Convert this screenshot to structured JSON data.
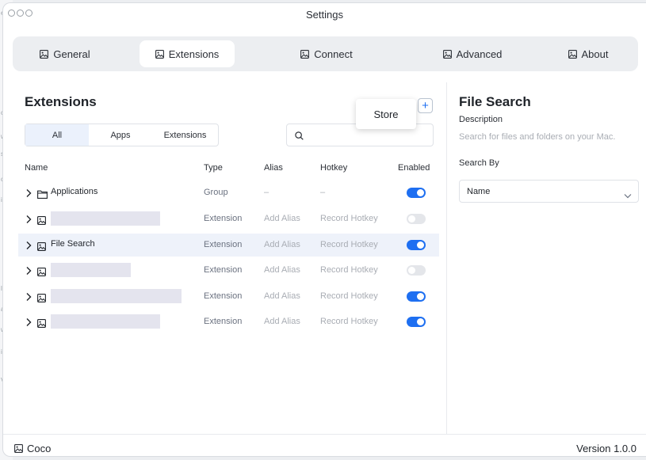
{
  "window": {
    "title": "Settings"
  },
  "tabs": [
    {
      "label": "General",
      "active": false
    },
    {
      "label": "Extensions",
      "active": true
    },
    {
      "label": "Connect",
      "active": false
    },
    {
      "label": "Advanced",
      "active": false
    },
    {
      "label": "About",
      "active": false
    }
  ],
  "extensions": {
    "title": "Extensions",
    "store_label": "Store",
    "add_label": "+",
    "filters": [
      {
        "label": "All",
        "active": true
      },
      {
        "label": "Apps",
        "active": false
      },
      {
        "label": "Extensions",
        "active": false
      }
    ],
    "search": {
      "value": "",
      "placeholder": ""
    },
    "columns": {
      "name": "Name",
      "type": "Type",
      "alias": "Alias",
      "hotkey": "Hotkey",
      "enabled": "Enabled"
    },
    "rows": [
      {
        "name": "Applications",
        "icon": "folder-icon",
        "type": "Group",
        "alias": "–",
        "hotkey": "–",
        "enabled": true,
        "selected": false
      },
      {
        "name": "",
        "icon": "image-icon",
        "type": "Extension",
        "alias": "Add Alias",
        "hotkey": "Record Hotkey",
        "enabled": false,
        "selected": false
      },
      {
        "name": "File Search",
        "icon": "image-icon",
        "type": "Extension",
        "alias": "Add Alias",
        "hotkey": "Record Hotkey",
        "enabled": true,
        "selected": true
      },
      {
        "name": "",
        "icon": "image-icon",
        "type": "Extension",
        "alias": "Add Alias",
        "hotkey": "Record Hotkey",
        "enabled": false,
        "selected": false
      },
      {
        "name": "",
        "icon": "image-icon",
        "type": "Extension",
        "alias": "Add Alias",
        "hotkey": "Record Hotkey",
        "enabled": true,
        "selected": false
      },
      {
        "name": "",
        "icon": "image-icon",
        "type": "Extension",
        "alias": "Add Alias",
        "hotkey": "Record Hotkey",
        "enabled": true,
        "selected": false
      }
    ]
  },
  "details": {
    "title": "File Search",
    "description_label": "Description",
    "description": "Search for files and folders on your Mac.",
    "search_by_label": "Search By",
    "search_by_value": "Name"
  },
  "footer": {
    "app_name": "Coco",
    "version": "Version 1.0.0"
  },
  "colors": {
    "accent": "#1e6ff1",
    "selected_row": "#eef2fa",
    "toggle_off": "#e4e6ea",
    "redacted": "#e4e4ee"
  }
}
